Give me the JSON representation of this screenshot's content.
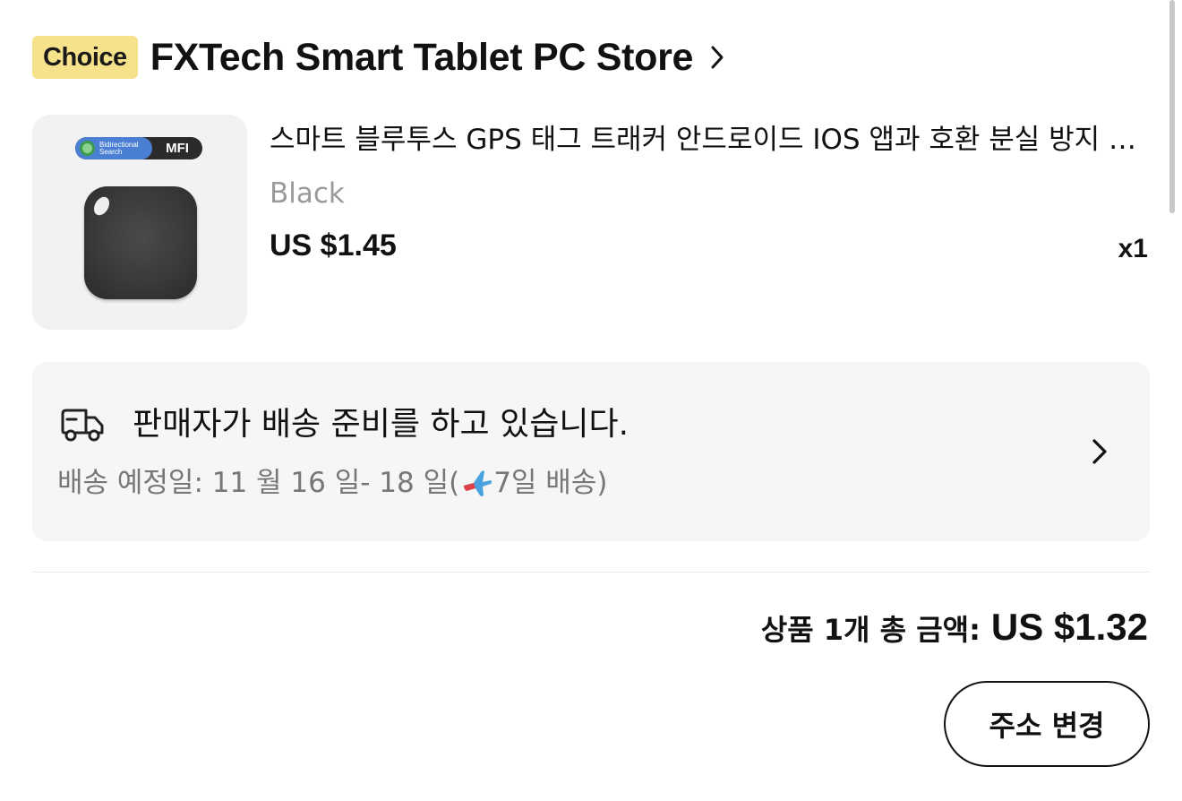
{
  "store": {
    "badge": "Choice",
    "name": "FXTech Smart Tablet PC Store"
  },
  "product": {
    "image_badge_left": "Bidirectional Search",
    "image_badge_right": "MFI",
    "title": "스마트 블루투스 GPS 태그 트래커 안드로이드 IOS 앱과 호환 분실 방지 스마트 파인더",
    "variant": "Black",
    "price": "US $1.45",
    "quantity": "x1"
  },
  "shipping": {
    "status": "판매자가 배송 준비를 하고 있습니다.",
    "eta_prefix": "배송 예정일: 11 월 16 일- 18 일(",
    "eta_suffix": "7일 배송)"
  },
  "summary": {
    "total_label": "상품 1개 총 금액:",
    "total_amount": "US $1.32"
  },
  "actions": {
    "change_address": "주소 변경"
  },
  "colors": {
    "choice_badge": "#f5e28a",
    "card_bg": "#f6f6f6",
    "plane_icon_blue": "#4aa3df",
    "plane_icon_red": "#e0424b"
  },
  "icons": {
    "store_chevron": "chevron-right-icon",
    "truck": "truck-icon",
    "plane": "airplane-icon",
    "shipping_chevron": "chevron-right-icon"
  }
}
